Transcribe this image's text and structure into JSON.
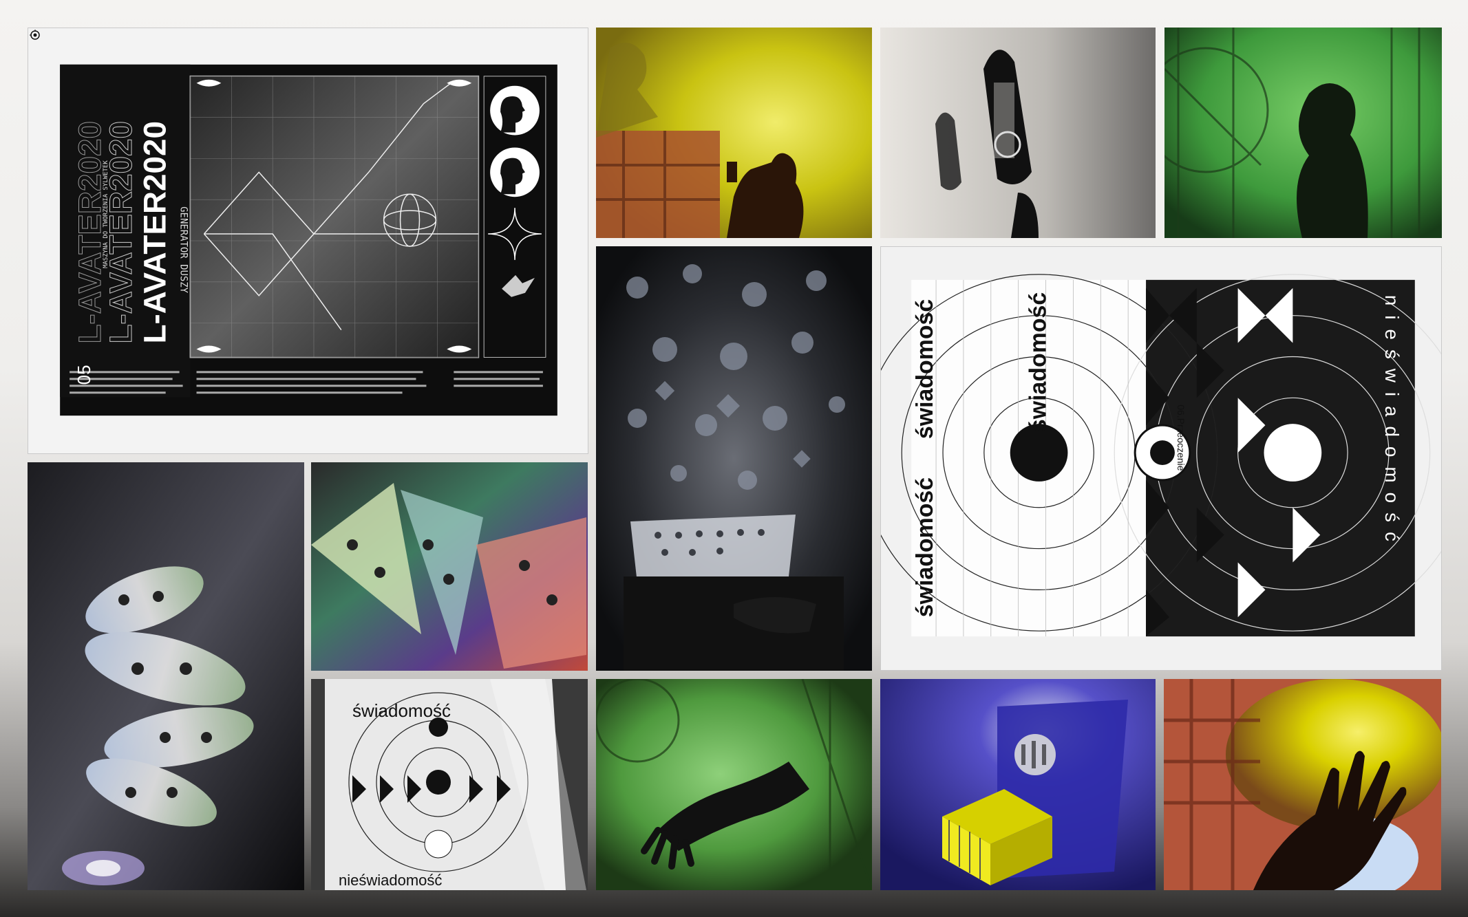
{
  "lavater_poster": {
    "number": "05",
    "title": "L-AVATER2020",
    "subtitle": "GENERATOR DUSZY",
    "subtitle2": "MASZYNA DO TWORZENIA SYLWETEK"
  },
  "swiadomosc_poster": {
    "word_top": "świadomość",
    "word_mid": "świadomość",
    "word_bottom": "świadomość",
    "ring_label": "06.Przeoczenie",
    "right_letters": "nieświadomość"
  },
  "swiadomosc_photo": {
    "word_top": "świadomość",
    "word_bottom": "nieświadomość"
  },
  "colors": {
    "yellow": "#d9d000",
    "green": "#3e9a3c",
    "blue": "#2e2aa8",
    "terracotta": "#b4553a"
  },
  "icons": {
    "corner": "crosshair-icon"
  }
}
